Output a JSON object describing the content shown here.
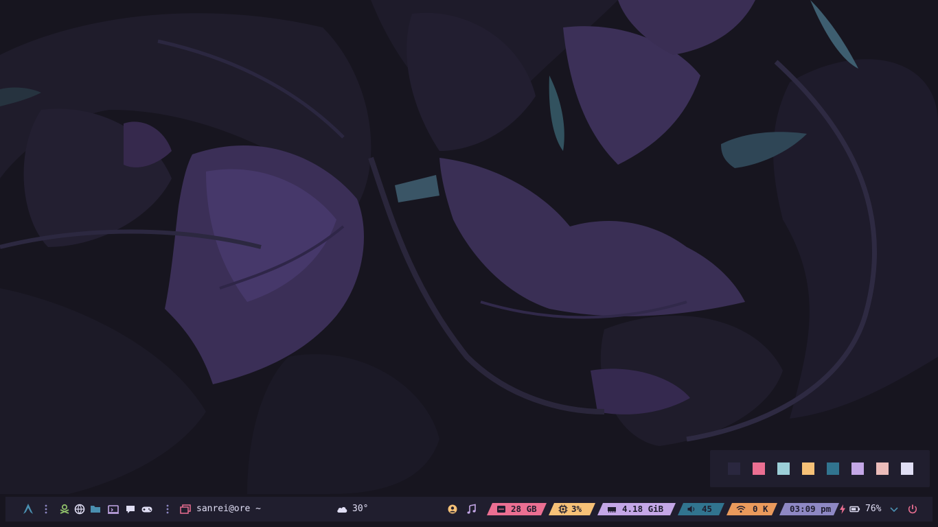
{
  "colors": {
    "bar_bg": "#201e2e",
    "accent_blue": "#4a8fb0",
    "disk": "#eb6f92",
    "cpu": "#f6c177",
    "memory": "#c4a7e7",
    "volume": "#31748f",
    "network": "#ea9a5c",
    "clock": "#8e88c4",
    "battery_icon": "#eb6f92",
    "power_icon": "#eb6f92"
  },
  "palette": [
    "#2a273f",
    "#eb6f92",
    "#9ccfd8",
    "#f6c177",
    "#31748f",
    "#c4a7e7",
    "#ebbcba",
    "#e0def4"
  ],
  "bar": {
    "workspace_label": "sanrei@ore ~",
    "weather_temp": "30°",
    "disk": "28 GB",
    "cpu": "3%",
    "memory": "4.18 GiB",
    "volume": "45",
    "network": "0 K",
    "clock": "03:09 pm",
    "battery": "76%"
  }
}
